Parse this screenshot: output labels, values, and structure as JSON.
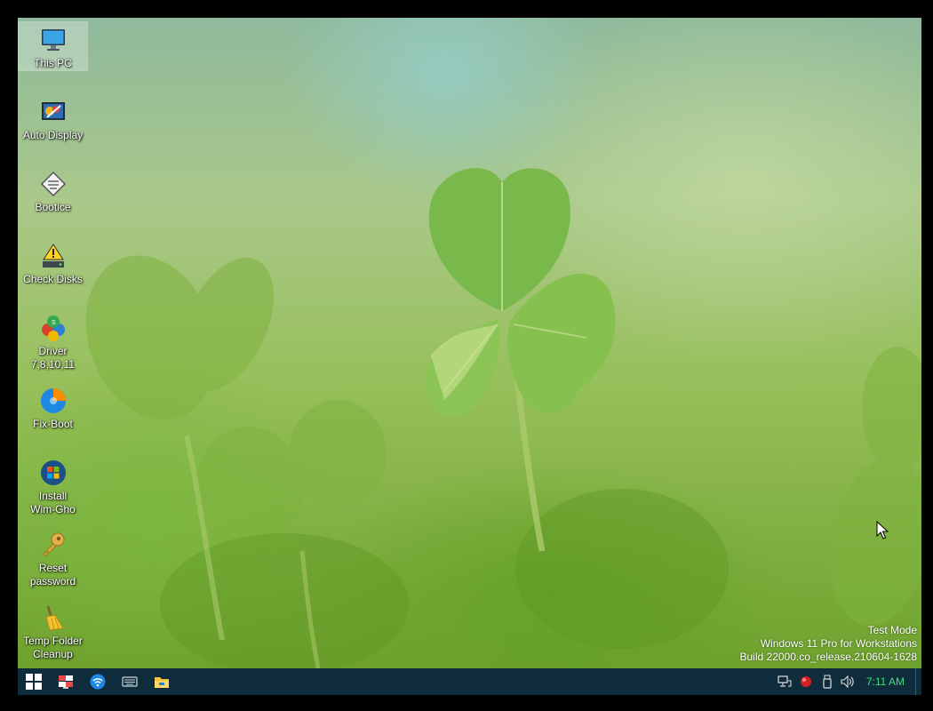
{
  "desktop_icons": [
    {
      "label": "This PC",
      "icon": "monitor-icon",
      "selected": true
    },
    {
      "label": "Auto Display",
      "icon": "display-settings-icon"
    },
    {
      "label": "Bootice",
      "icon": "bootice-icon"
    },
    {
      "label": "Check Disks",
      "icon": "disk-warning-icon"
    },
    {
      "label": "Driver\n7,8,10,11",
      "icon": "driver-icon"
    },
    {
      "label": "Fix-Boot",
      "icon": "fix-boot-icon"
    },
    {
      "label": "Install\nWim-Gho",
      "icon": "windows-orb-icon"
    },
    {
      "label": "Reset\npassword",
      "icon": "key-icon"
    },
    {
      "label": "Temp Folder\nCleanup",
      "icon": "broom-icon"
    }
  ],
  "watermark": {
    "line1": "Test Mode",
    "line2": "Windows 11 Pro for Workstations",
    "line3": "Build 22000.co_release.210604-1628"
  },
  "taskbar": {
    "buttons": [
      "start-icon",
      "network-tool-icon",
      "wifi-icon",
      "keyboard-icon",
      "file-explorer-icon"
    ],
    "tray": [
      "network-icon",
      "app-tray-icon",
      "usb-icon",
      "volume-icon"
    ],
    "clock": "7:11 AM",
    "clock_color": "#3fe07a",
    "background": "#0f2c3d"
  }
}
